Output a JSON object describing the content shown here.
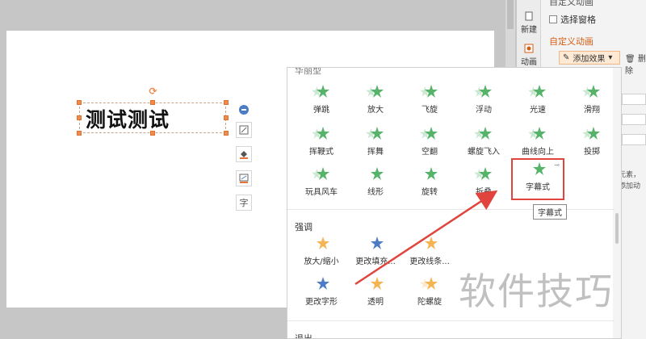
{
  "slide": {
    "text_box": "测试测试"
  },
  "quick_tools": {
    "text_tool_glyph": "字"
  },
  "side_tabs": [
    {
      "label": "新建"
    },
    {
      "label": "动画"
    }
  ],
  "pane": {
    "top_partial": "自定义动画",
    "select_pane": "选择窗格",
    "title": "自定义动画",
    "add_effect": "添加效果",
    "delete": "删除",
    "desc_line1": "元素，",
    "desc_line2": "添加动"
  },
  "dropdown": {
    "category_top": "华丽型",
    "row1": [
      "弹跳",
      "放大",
      "飞旋",
      "浮动",
      "光速",
      "滑翔"
    ],
    "row2": [
      "挥鞭式",
      "挥舞",
      "空翻",
      "螺旋飞入",
      "曲线向上",
      "投掷"
    ],
    "row3": [
      "玩具风车",
      "线形",
      "旋转",
      "折叠",
      "字幕式"
    ],
    "category_emphasis": "强调",
    "emph_row1": [
      "放大/缩小",
      "更改填充...",
      "更改线条..."
    ],
    "emph_row2": [
      "更改字形",
      "透明",
      "陀螺旋"
    ],
    "category_exit": "退出"
  },
  "tooltip": "字幕式",
  "watermark": "软件技巧",
  "colors": {
    "star_green": "#56b36a",
    "star_gold": "#f4b451",
    "highlight_red": "#e0443c",
    "accent_orange": "#d45d14"
  }
}
